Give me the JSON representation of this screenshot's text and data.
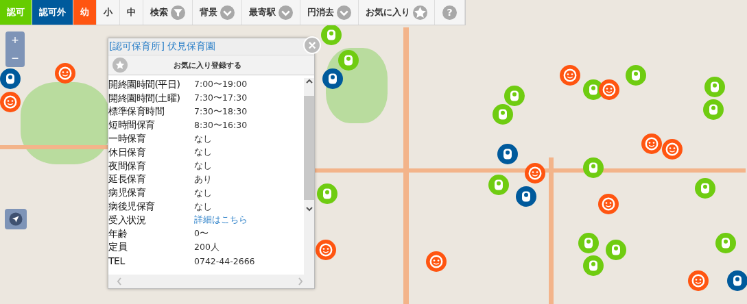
{
  "toolbar": [
    {
      "kind": "layer",
      "label": "認可",
      "color": "#66cc00",
      "selected": true
    },
    {
      "kind": "layer",
      "label": "認可外",
      "color": "#005a9c",
      "selected": true
    },
    {
      "kind": "layer",
      "label": "幼",
      "color": "#ff5511",
      "selected": true
    },
    {
      "kind": "text",
      "label": "小"
    },
    {
      "kind": "text",
      "label": "中"
    },
    {
      "kind": "filter",
      "label": "検索"
    },
    {
      "kind": "dropdown",
      "label": "背景"
    },
    {
      "kind": "dropdown",
      "label": "最寄駅"
    },
    {
      "kind": "dropdown",
      "label": "円消去"
    },
    {
      "kind": "favorite",
      "label": "お気に入り"
    },
    {
      "kind": "help",
      "label": "?"
    }
  ],
  "zoom_controls": {
    "plus": "+",
    "minus": "−"
  },
  "markers": [
    {
      "kind": "kindergarten"
    },
    {
      "kind": "nursery"
    },
    {
      "kind": "unlicensed"
    },
    {
      "kind": "kindergarten"
    },
    {
      "kind": "unlicensed"
    },
    {
      "kind": "nursery"
    },
    {
      "kind": "nursery"
    },
    {
      "kind": "nursery"
    },
    {
      "kind": "kindergarten"
    },
    {
      "kind": "nursery"
    },
    {
      "kind": "nursery"
    },
    {
      "kind": "kindergarten"
    },
    {
      "kind": "nursery"
    },
    {
      "kind": "unlicensed"
    },
    {
      "kind": "nursery"
    },
    {
      "kind": "kindergarten"
    },
    {
      "kind": "kindergarten"
    },
    {
      "kind": "nursery"
    },
    {
      "kind": "unlicensed"
    },
    {
      "kind": "nursery"
    },
    {
      "kind": "kindergarten"
    },
    {
      "kind": "nursery"
    },
    {
      "kind": "kindergarten"
    },
    {
      "kind": "nursery"
    },
    {
      "kind": "nursery"
    },
    {
      "kind": "kindergarten"
    },
    {
      "kind": "nursery"
    },
    {
      "kind": "unlicensed"
    },
    {
      "kind": "kindergarten"
    },
    {
      "kind": "nursery"
    },
    {
      "kind": "nursery"
    },
    {
      "kind": "kindergarten"
    }
  ],
  "popup": {
    "category": "[認可保育所]",
    "name": "伏見保育園",
    "close": "×",
    "favorite_label": "お気に入り登録する",
    "rows": [
      {
        "label": "開終園時間(平日)",
        "value": "7:00〜19:00"
      },
      {
        "label": "開終園時間(土曜)",
        "value": "7:30〜17:30"
      },
      {
        "label": "標準保育時間",
        "value": "7:30〜18:30"
      },
      {
        "label": "短時間保育",
        "value": "8:30〜16:30"
      },
      {
        "label": "一時保育",
        "value": "なし"
      },
      {
        "label": "休日保育",
        "value": "なし"
      },
      {
        "label": "夜間保育",
        "value": "なし"
      },
      {
        "label": "延長保育",
        "value": "あり"
      },
      {
        "label": "病児保育",
        "value": "なし"
      },
      {
        "label": "病後児保育",
        "value": "なし"
      },
      {
        "label": "受入状況",
        "value": "詳細はこちら",
        "kind": "link"
      },
      {
        "label": "年齢",
        "value": "0〜"
      },
      {
        "label": "定員",
        "value": "200人"
      },
      {
        "label": "TEL",
        "value": "0742-44-2666"
      }
    ]
  }
}
